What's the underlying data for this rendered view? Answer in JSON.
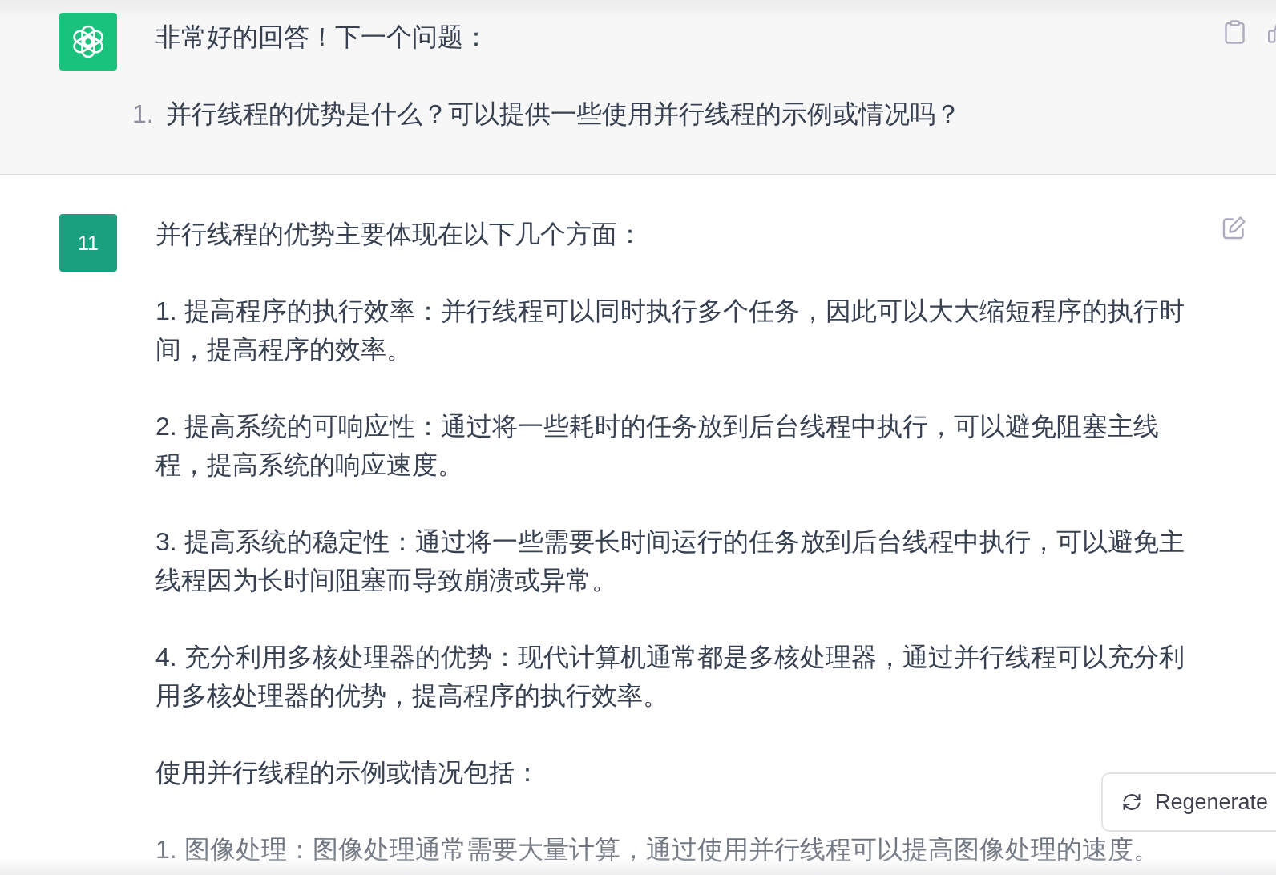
{
  "messages": [
    {
      "kind": "assistant",
      "paragraphs": [
        {
          "kind": "text",
          "text": "非常好的回答！下一个问题："
        },
        {
          "kind": "list_item",
          "number": "1.",
          "text": "并行线程的优势是什么？可以提供一些使用并行线程的示例或情况吗？"
        }
      ]
    },
    {
      "kind": "user",
      "avatar": "11",
      "paragraphs": [
        {
          "kind": "text",
          "text": "并行线程的优势主要体现在以下几个方面："
        },
        {
          "kind": "text",
          "text": "1. 提高程序的执行效率：并行线程可以同时执行多个任务，因此可以大大缩短程序的执行时间，提高程序的效率。"
        },
        {
          "kind": "text",
          "text": "2. 提高系统的可响应性：通过将一些耗时的任务放到后台线程中执行，可以避免阻塞主线程，提高系统的响应速度。"
        },
        {
          "kind": "text",
          "text": "3. 提高系统的稳定性：通过将一些需要长时间运行的任务放到后台线程中执行，可以避免主线程因为长时间阻塞而导致崩溃或异常。"
        },
        {
          "kind": "text",
          "text": "4. 充分利用多核处理器的优势：现代计算机通常都是多核处理器，通过并行线程可以充分利用多核处理器的优势，提高程序的执行效率。"
        },
        {
          "kind": "text",
          "text": "使用并行线程的示例或情况包括："
        },
        {
          "kind": "text",
          "text": "1. 图像处理：图像处理通常需要大量计算，通过使用并行线程可以提高图像处理的速度。"
        }
      ]
    }
  ],
  "regenerate_button": {
    "label": "Regenerate"
  }
}
